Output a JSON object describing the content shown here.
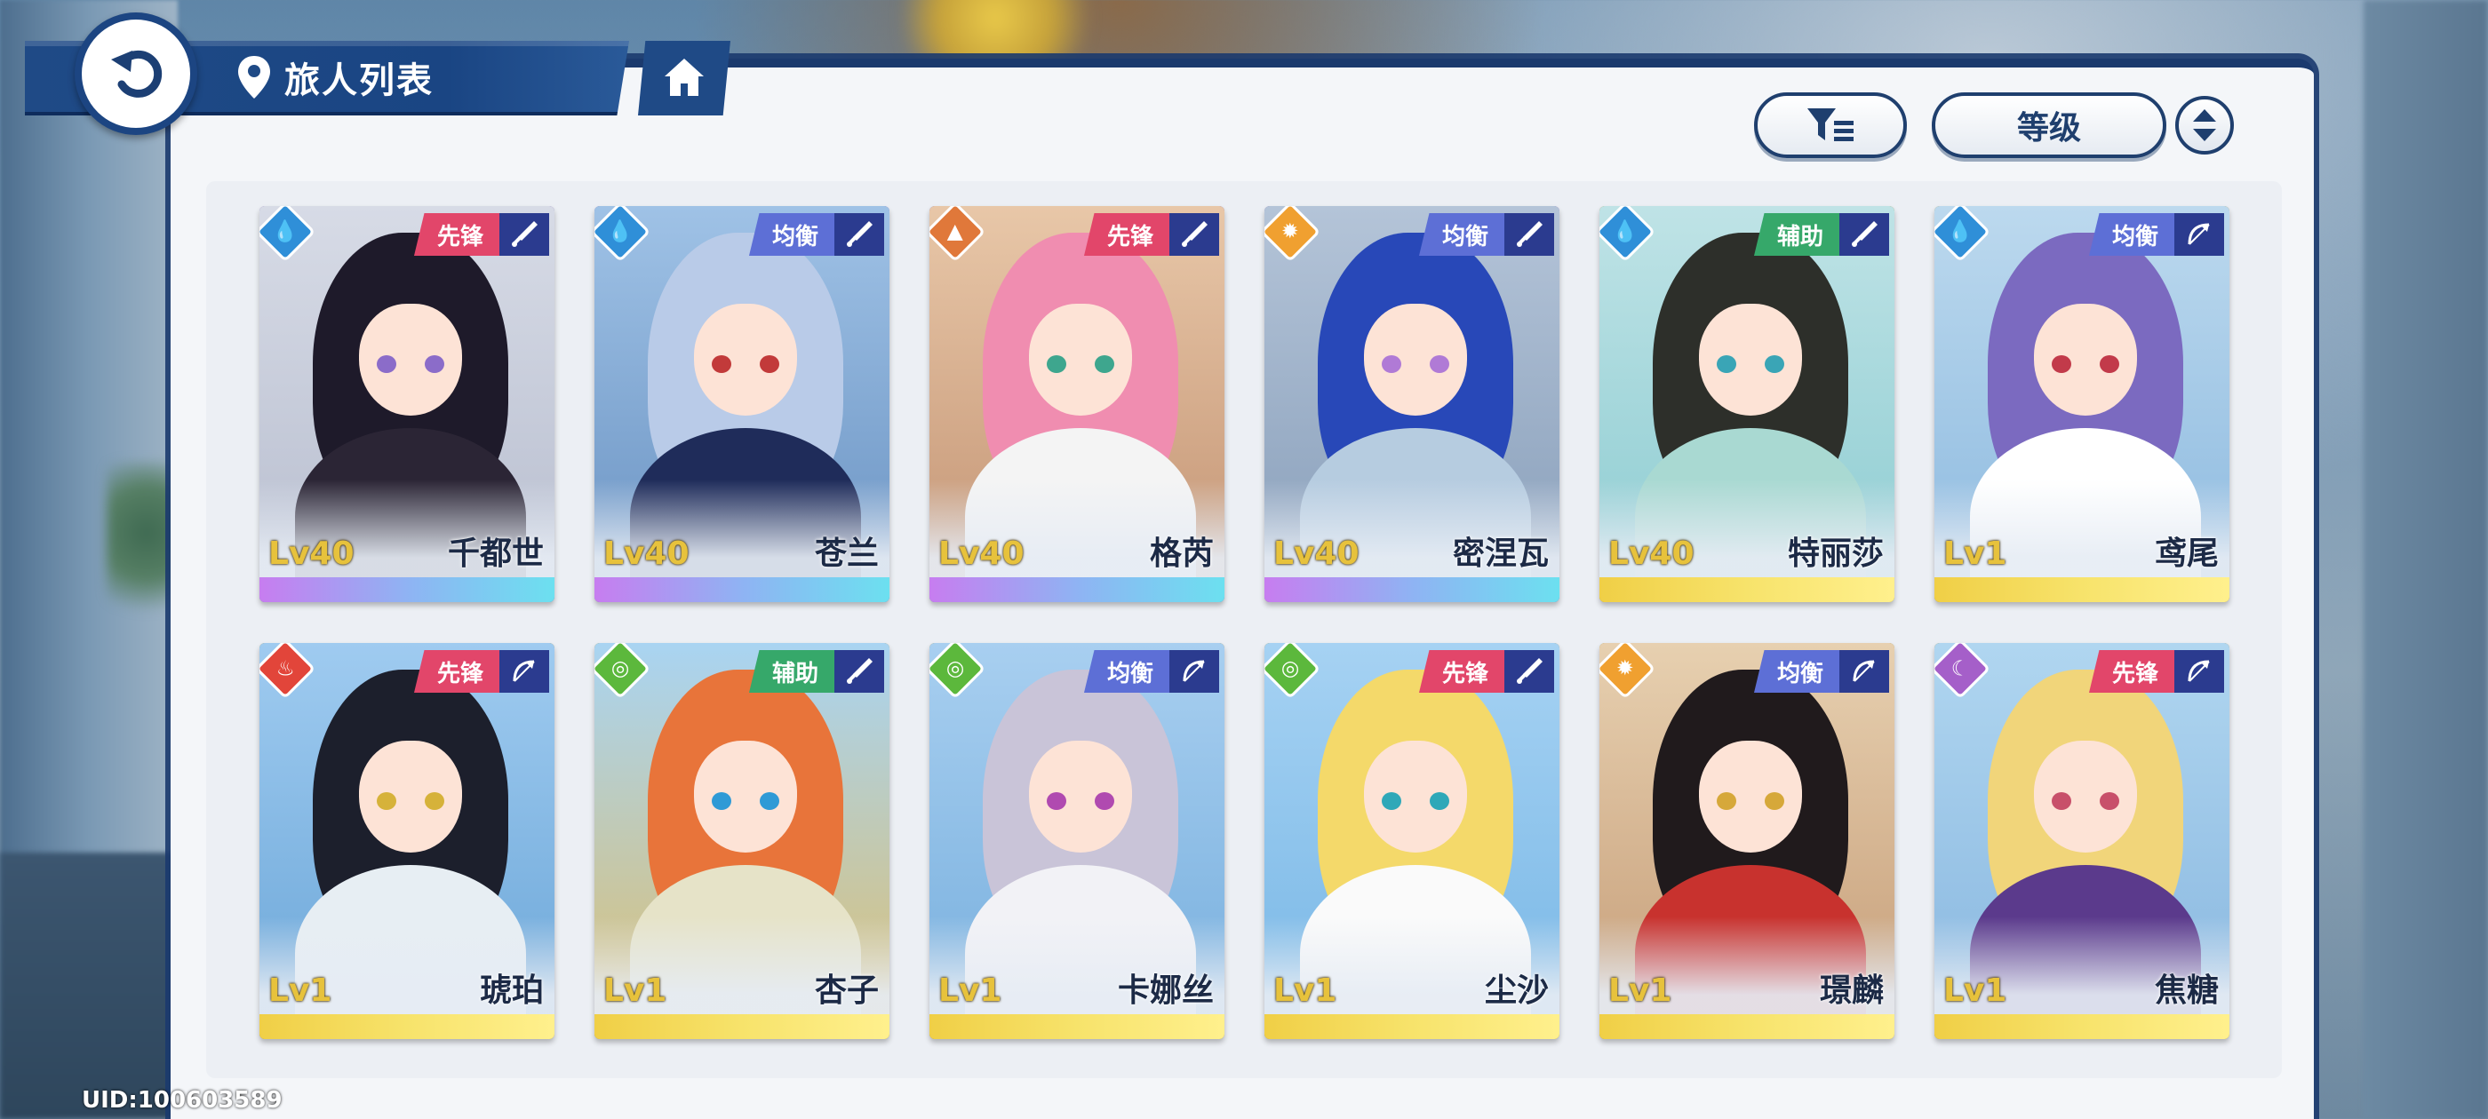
{
  "header": {
    "title": "旅人列表",
    "back_icon": "back-arrow-icon",
    "location_icon": "map-pin-icon",
    "home_icon": "home-icon"
  },
  "toolbar": {
    "filter_icon": "filter-icon",
    "sort_label": "等级",
    "order_icon": "sort-order-icon"
  },
  "colors": {
    "navy": "#1f4a86",
    "vanguard": "#e2466a",
    "balance": "#5d6fd6",
    "support": "#36a86a",
    "level_gold": "#e7c23c"
  },
  "characters": [
    {
      "name": "千都世",
      "level": "Lv40",
      "role": "先锋",
      "element": "water",
      "weapon": "sword",
      "rarity": "rainbow"
    },
    {
      "name": "苍兰",
      "level": "Lv40",
      "role": "均衡",
      "element": "water",
      "weapon": "sword",
      "rarity": "rainbow"
    },
    {
      "name": "格芮",
      "level": "Lv40",
      "role": "先锋",
      "element": "earth",
      "weapon": "sword",
      "rarity": "rainbow"
    },
    {
      "name": "密涅瓦",
      "level": "Lv40",
      "role": "均衡",
      "element": "light",
      "weapon": "sword",
      "rarity": "rainbow"
    },
    {
      "name": "特丽莎",
      "level": "Lv40",
      "role": "辅助",
      "element": "water",
      "weapon": "sword",
      "rarity": "gold"
    },
    {
      "name": "鸢尾",
      "level": "Lv1",
      "role": "均衡",
      "element": "water",
      "weapon": "bow",
      "rarity": "gold"
    },
    {
      "name": "琥珀",
      "level": "Lv1",
      "role": "先锋",
      "element": "fire",
      "weapon": "bow",
      "rarity": "gold"
    },
    {
      "name": "杏子",
      "level": "Lv1",
      "role": "辅助",
      "element": "wind",
      "weapon": "sword",
      "rarity": "gold"
    },
    {
      "name": "卡娜丝",
      "level": "Lv1",
      "role": "均衡",
      "element": "wind",
      "weapon": "bow",
      "rarity": "gold"
    },
    {
      "name": "尘沙",
      "level": "Lv1",
      "role": "先锋",
      "element": "wind",
      "weapon": "sword",
      "rarity": "gold"
    },
    {
      "name": "璟麟",
      "level": "Lv1",
      "role": "均衡",
      "element": "light",
      "weapon": "bow",
      "rarity": "gold"
    },
    {
      "name": "焦糖",
      "level": "Lv1",
      "role": "先锋",
      "element": "dark",
      "weapon": "bow",
      "rarity": "gold"
    }
  ],
  "footer": {
    "uid": "UID:100603589"
  }
}
